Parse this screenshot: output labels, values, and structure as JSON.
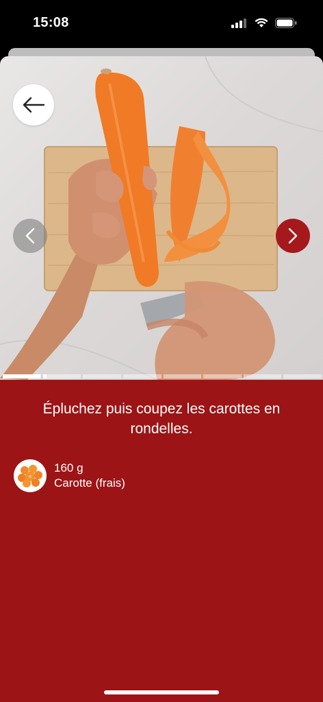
{
  "status_bar": {
    "time": "15:08"
  },
  "step": {
    "instruction": "Épluchez puis coupez les carottes en rondelles.",
    "progress": {
      "segments": 8,
      "current_index": 0,
      "current_fill_fraction": 0.98,
      "second_fill_fraction": 0.1
    }
  },
  "ingredients": [
    {
      "quantity": "160 g",
      "name": "Carotte (frais)",
      "icon": "carrot-slices-icon"
    }
  ],
  "colors": {
    "accent": "#9c1416",
    "next_button": "#a5191c"
  }
}
